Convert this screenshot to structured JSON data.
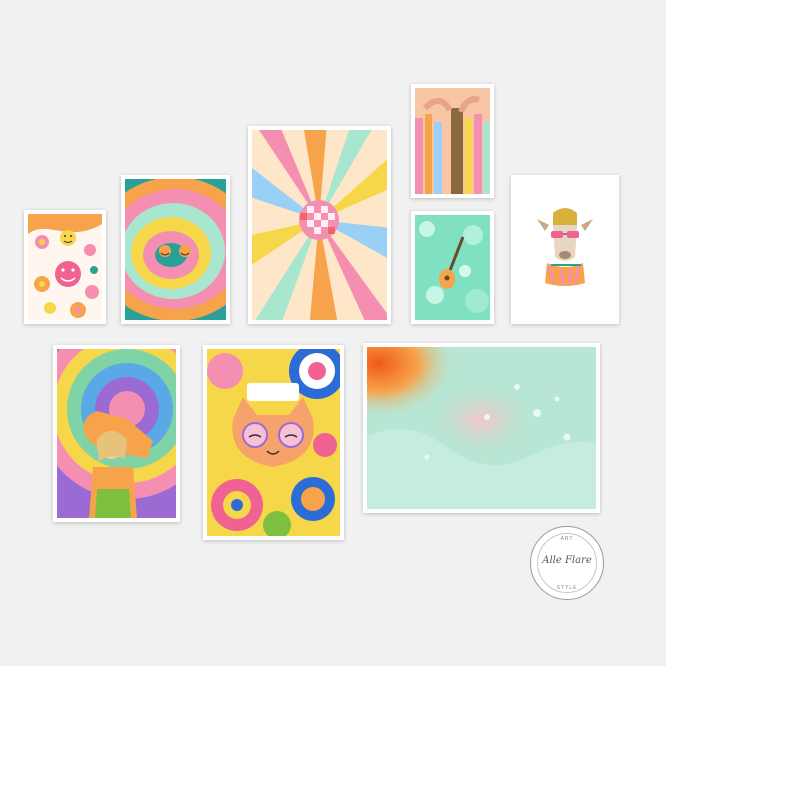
{
  "scene": "gallery-wall",
  "colors": {
    "wall": "#f1f1f1",
    "frame": "#ffffff",
    "pink": "#f48fb1",
    "orange": "#f7a34b",
    "teal": "#2aa198",
    "yellow": "#f6d74a",
    "mint": "#a8e6cf",
    "purple": "#9b6bd3"
  },
  "prints": [
    {
      "id": "smiley-flowers",
      "icon": "smiley-flower-icon"
    },
    {
      "id": "swirl-smileys",
      "icon": "swirl-icon"
    },
    {
      "id": "disco-ball-rays",
      "icon": "disco-ball-icon"
    },
    {
      "id": "ribbon-hands",
      "icon": "hands-icon"
    },
    {
      "id": "guitar-bubbles",
      "icon": "guitar-icon"
    },
    {
      "id": "llama-portrait",
      "icon": "llama-icon"
    },
    {
      "id": "tie-dye-portrait",
      "icon": "person-icon"
    },
    {
      "id": "love-cat-flowers",
      "icon": "cat-icon"
    },
    {
      "id": "abstract-fluid",
      "icon": "abstract-icon"
    }
  ],
  "brand_stamp": {
    "script_text": "Alle Flare",
    "top_text": "ART",
    "bottom_text": "STYLE"
  }
}
